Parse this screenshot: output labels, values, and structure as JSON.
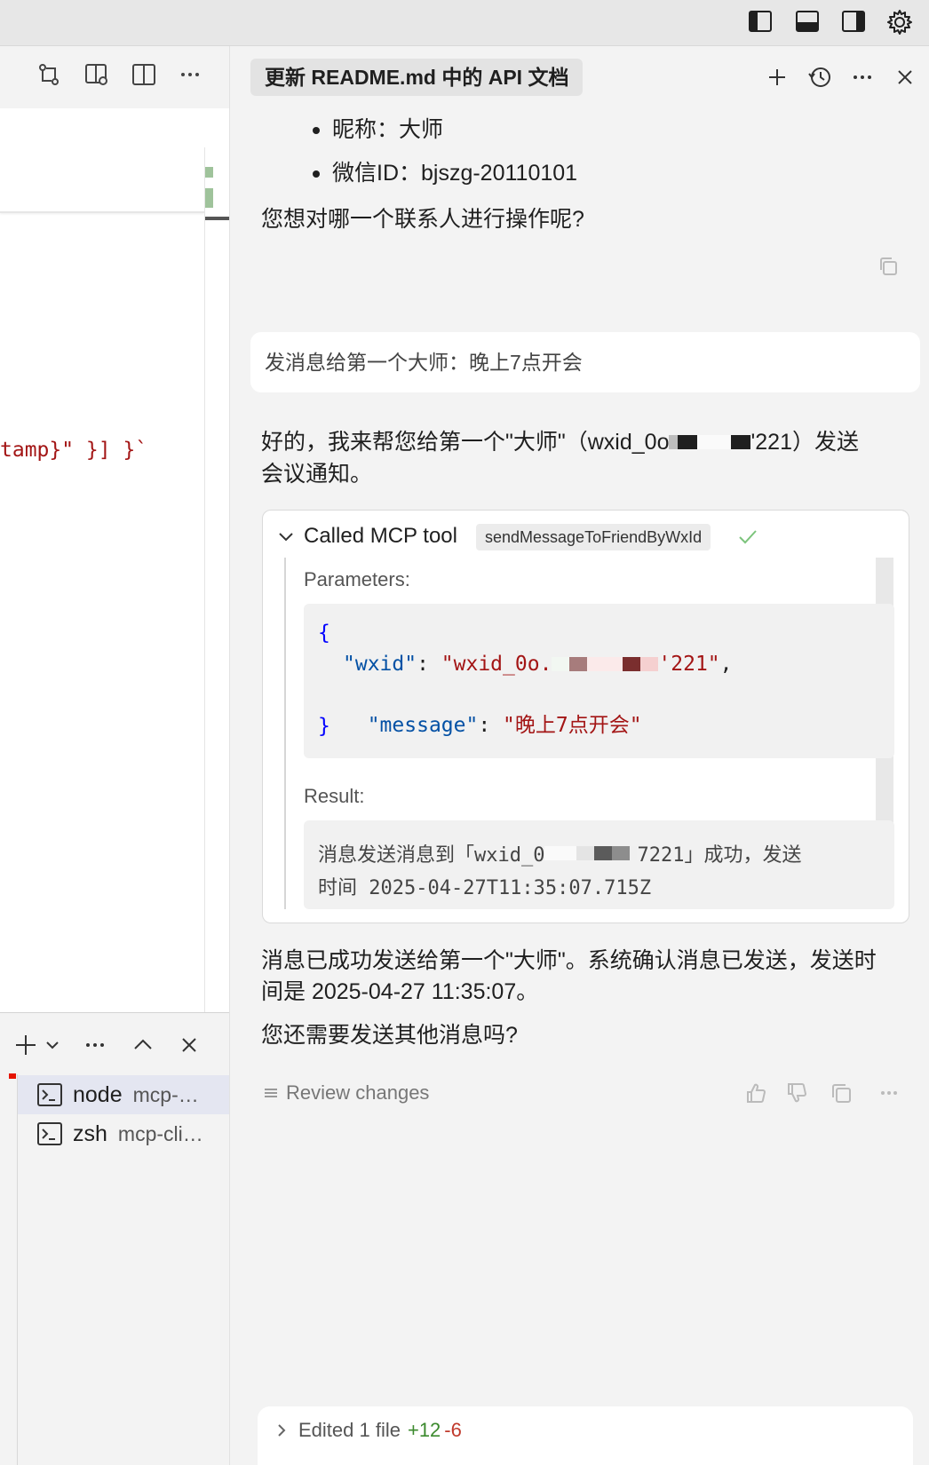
{
  "window": {
    "title_icons": [
      "toggle-primary-sidebar-icon",
      "toggle-panel-icon",
      "toggle-secondary-sidebar-icon",
      "settings-gear-icon"
    ]
  },
  "editor": {
    "toolbar_icons": [
      "source-control-compare-icon",
      "open-preview-icon",
      "split-editor-icon",
      "more-actions-icon"
    ],
    "code_fragment": "tamp}\" }] }`"
  },
  "terminal": {
    "toolbar_icons": [
      "new-terminal-icon",
      "terminal-dropdown-icon",
      "more-actions-icon",
      "maximize-panel-icon",
      "close-panel-icon"
    ],
    "items": [
      {
        "name": "node",
        "detail": "mcp-…",
        "selected": true
      },
      {
        "name": "zsh",
        "detail": "mcp-cli…",
        "selected": false
      }
    ]
  },
  "chat": {
    "tab_title": "更新 README.md 中的 API 文档",
    "header_icons": [
      "new-chat-icon",
      "history-icon",
      "more-actions-icon",
      "close-icon"
    ],
    "bullets": [
      "昵称：大师",
      "微信ID：bjszg-20110101"
    ],
    "question": "您想对哪一个联系人进行操作呢?",
    "user_message": "发消息给第一个大师：晚上7点开会",
    "assistant_intro_line1_a": "好的，我来帮您给第一个\"大师\"（wxid_0o",
    "assistant_intro_line1_b": "'221）发送",
    "assistant_intro_line2": "会议通知。",
    "tool": {
      "header": "Called MCP tool",
      "tool_name": "sendMessageToFriendByWxId",
      "parameters_label": "Parameters:",
      "param_open": "{",
      "param_wxid_key": "\"wxid\"",
      "param_wxid_value_a": "\"wxid_0o.",
      "param_wxid_value_b": "'221\"",
      "param_message_key": "\"message\"",
      "param_message_value": "\"晚上7点开会\"",
      "param_close": "}",
      "result_label": "Result:",
      "result_line1_a": "消息发送消息到「wxid_0",
      "result_line1_b": "7221」成功，发送",
      "result_line2": "时间 2025-04-27T11:35:07.715Z"
    },
    "final_line1": "消息已成功发送给第一个\"大师\"。系统确认消息已发送，发送时",
    "final_line2": "间是 2025-04-27 11:35:07。",
    "followup": "您还需要发送其他消息吗?",
    "review_label": "Review changes",
    "feedback_icons": [
      "thumbs-up-icon",
      "thumbs-down-icon",
      "copy-icon",
      "more-actions-icon"
    ],
    "edited_label": "Edited 1 file",
    "edited_added": "+12",
    "edited_removed": "-6"
  },
  "colors": {
    "accent_green": "#3c8a2e",
    "removed_red": "#c0392b",
    "json_key": "#0451a5",
    "json_string": "#a31515"
  }
}
